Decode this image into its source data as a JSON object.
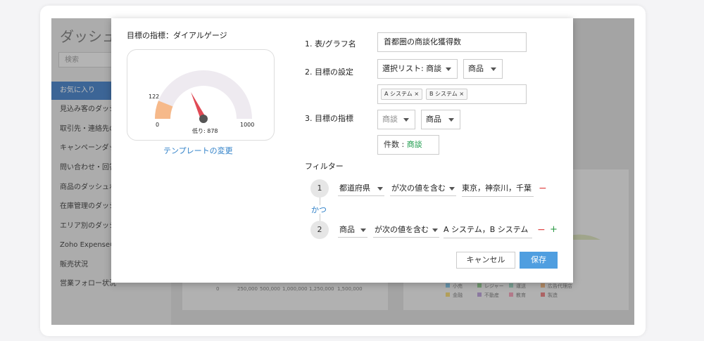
{
  "background": {
    "sidebar_title": "ダッシュボ",
    "search_placeholder": "検索",
    "sidebar_items": [
      "お気に入り",
      "見込み客のダッシュ",
      "取引先・連絡先の",
      "キャンペーンダッシ",
      "問い合わせ・回答",
      "商品のダッシュボー",
      "在庫管理のダッシュ",
      "エリア別のダッシュ",
      "Zoho Expenseの",
      "販売状況",
      "営業フォロー状況"
    ],
    "chart_axis_labels": [
      "0",
      "250,000",
      "500,000",
      "1,000,000",
      "1,250,000",
      "1,500,000"
    ],
    "legend_items": [
      "小売",
      "レジャー",
      "運送",
      "広告代理店",
      "金融",
      "不動産",
      "教育",
      "製造"
    ],
    "colors": {
      "blue": "#7ec3e6",
      "green": "#8fc98a",
      "teal": "#9ad3c0",
      "orange": "#f0b27a",
      "yellow": "#f2d46b",
      "purple": "#b59ad6",
      "pink": "#f29ab3",
      "red": "#e8797a"
    }
  },
  "modal": {
    "gauge": {
      "title": "目標の指標：ダイアルゲージ",
      "min_label": "0",
      "max_label": "1000",
      "target_label": "122",
      "current_label": "低り: 878",
      "min": 0,
      "max": 1000,
      "value": 122,
      "fill_color": "#f6b98a",
      "track_color": "#eeeaf0",
      "needle_color": "#e04a55",
      "template_link": "テンプレートの変更"
    },
    "form": {
      "name_label": "1. 表/グラフ名",
      "name_value": "首都圏の商談化獲得数",
      "target_label": "2. 目標の設定",
      "target_select": "選択リスト: 商談",
      "target_field": "商品",
      "tags": [
        "A システム",
        "B システム"
      ],
      "indicator_label": "3. 目標の指標",
      "indicator_module": "商談",
      "indicator_field": "商品",
      "count_label": "件数 :",
      "count_value": "商談"
    },
    "filter": {
      "title": "フィルター",
      "and_label": "かつ",
      "rows": [
        {
          "index": "1",
          "field": "都道府県",
          "operator": "が次の値を含む",
          "value": "東京，神奈川，千葉"
        },
        {
          "index": "2",
          "field": "商品",
          "operator": "が次の値を含む",
          "value": "A システム，B システム"
        }
      ]
    },
    "buttons": {
      "cancel": "キャンセル",
      "save": "保存"
    }
  }
}
